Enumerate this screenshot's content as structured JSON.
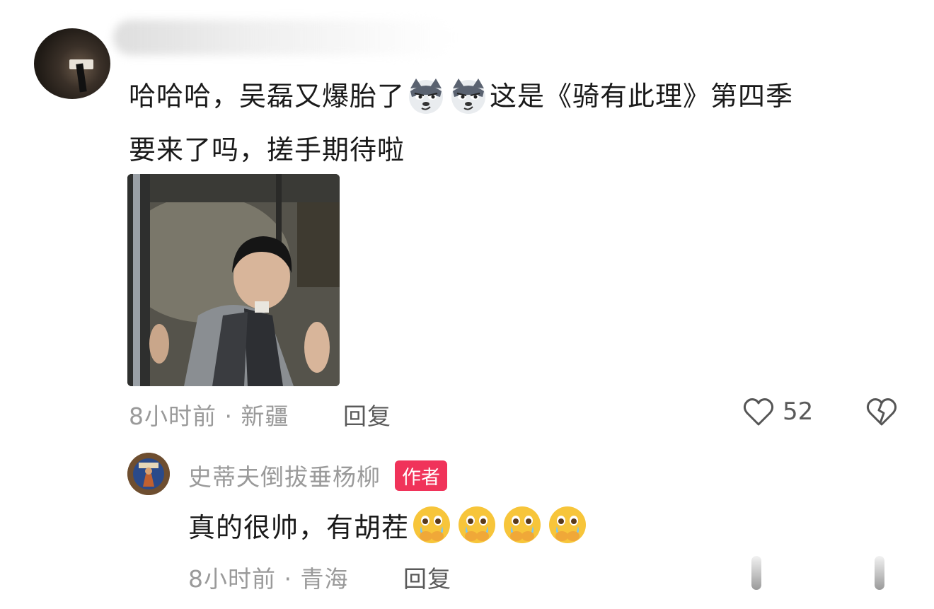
{
  "comment": {
    "text_part1": "哈哈哈，吴磊又爆胎了",
    "text_part2": "这是《骑有此理》第四季",
    "text_part3": "要来了吗，搓手期待啦",
    "emoji_name": "wolf-smirk-emoji",
    "time_location": "8小时前 · 新疆",
    "reply_label": "回复",
    "like_count": "52"
  },
  "reply": {
    "author": "史蒂夫倒拔垂杨柳",
    "author_badge": "作者",
    "text": "真的很帅，有胡茬",
    "emoji_name": "crying-face-covering-mouth-emoji",
    "time_location": "8小时前 · 青海",
    "reply_label": "回复"
  },
  "colors": {
    "badge": "#f0335a",
    "meta_text": "#9a9a9a",
    "body_text": "#1a1a1a"
  }
}
